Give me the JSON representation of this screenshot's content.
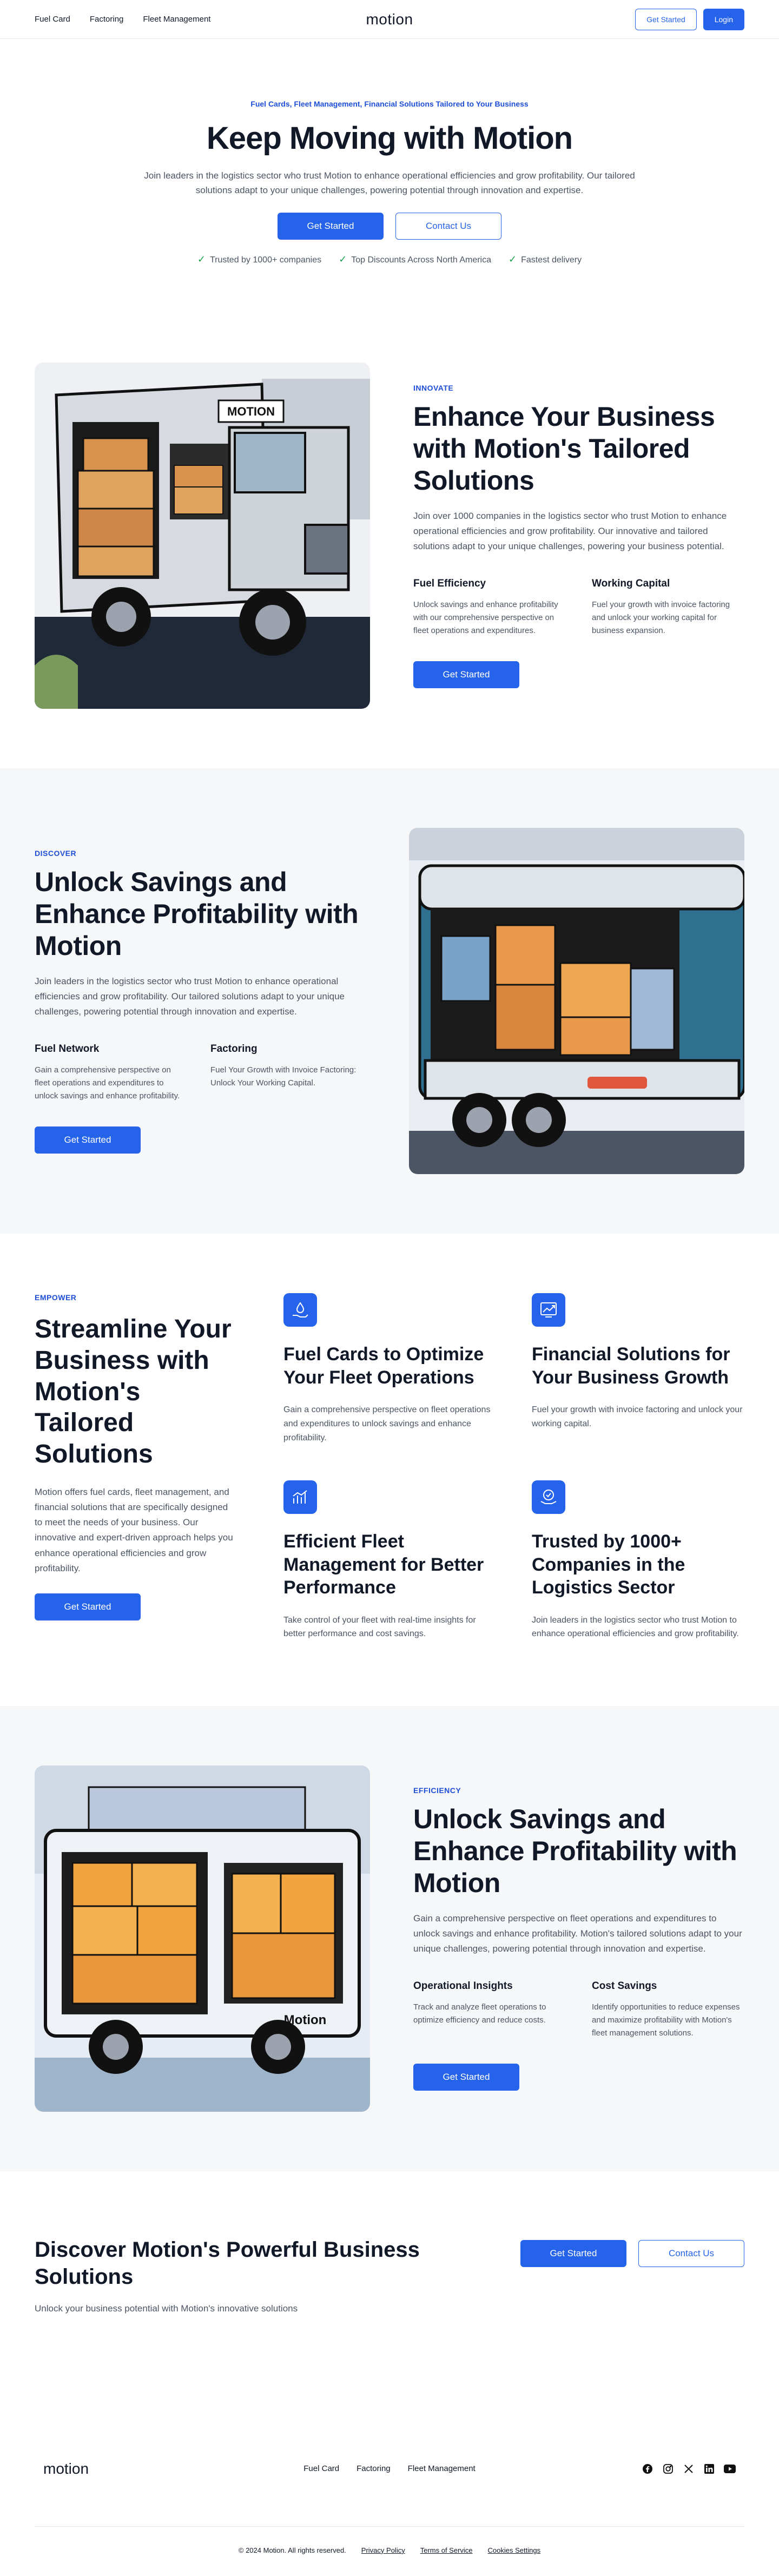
{
  "nav": {
    "links": [
      "Fuel Card",
      "Factoring",
      "Fleet Management"
    ],
    "logo": "motion",
    "get_started": "Get Started",
    "login": "Login"
  },
  "hero": {
    "eyebrow": "Fuel Cards, Fleet Management, Financial Solutions Tailored to Your Business",
    "title": "Keep Moving with Motion",
    "subtitle": "Join leaders in the logistics sector who trust Motion to enhance operational efficiencies and grow profitability. Our tailored solutions adapt to your unique challenges, powering potential through innovation and expertise.",
    "primary_btn": "Get Started",
    "secondary_btn": "Contact Us",
    "checks": [
      "Trusted by 1000+ companies",
      "Top Discounts Across North America",
      "Fastest delivery"
    ]
  },
  "innovate": {
    "eyebrow": "INNOVATE",
    "title": "Enhance Your Business with Motion's Tailored Solutions",
    "desc": "Join over 1000 companies in the logistics sector who trust Motion to enhance operational efficiencies and grow profitability. Our innovative and tailored solutions adapt to your unique challenges, powering your business potential.",
    "col1_title": "Fuel Efficiency",
    "col1_desc": "Unlock savings and enhance profitability with our comprehensive perspective on fleet operations and expenditures.",
    "col2_title": "Working Capital",
    "col2_desc": "Fuel your growth with invoice factoring and unlock your working capital for business expansion.",
    "button": "Get Started",
    "truck_label": "MOTION"
  },
  "discover": {
    "eyebrow": "DISCOVER",
    "title": "Unlock Savings and Enhance Profitability with Motion",
    "desc": "Join leaders in the logistics sector who trust Motion to enhance operational efficiencies and grow profitability. Our tailored solutions adapt to your unique challenges, powering potential through innovation and expertise.",
    "col1_title": "Fuel Network",
    "col1_desc": "Gain a comprehensive perspective on fleet operations and expenditures to unlock savings and enhance profitability.",
    "col2_title": "Factoring",
    "col2_desc": "Fuel Your Growth with Invoice Factoring: Unlock Your Working Capital.",
    "button": "Get Started"
  },
  "empower": {
    "eyebrow": "EMPOWER",
    "title": "Streamline Your Business with Motion's Tailored Solutions",
    "desc": "Motion offers fuel cards, fleet management, and financial solutions that are specifically designed to meet the needs of your business. Our innovative and expert-driven approach helps you enhance operational efficiencies and grow profitability.",
    "button": "Get Started",
    "cards": [
      {
        "icon": "fuel-hand-icon",
        "title": "Fuel Cards to Optimize Your Fleet Operations",
        "desc": "Gain a comprehensive perspective on fleet operations and expenditures to unlock savings and enhance profitability."
      },
      {
        "icon": "growth-chart-icon",
        "title": "Financial Solutions for Your Business Growth",
        "desc": "Fuel your growth with invoice factoring and unlock your working capital."
      },
      {
        "icon": "bar-chart-icon",
        "title": "Efficient Fleet Management for Better Performance",
        "desc": "Take control of your fleet with real-time insights for better performance and cost savings."
      },
      {
        "icon": "handshake-icon",
        "title": "Trusted by 1000+ Companies in the Logistics Sector",
        "desc": "Join leaders in the logistics sector who trust Motion to enhance operational efficiencies and grow profitability."
      }
    ]
  },
  "efficiency": {
    "eyebrow": "EFFICIENCY",
    "title": "Unlock Savings and Enhance Profitability with Motion",
    "desc": "Gain a comprehensive perspective on fleet operations and expenditures to unlock savings and enhance profitability. Motion's tailored solutions adapt to your unique challenges, powering potential through innovation and expertise.",
    "col1_title": "Operational Insights",
    "col1_desc": "Track and analyze fleet operations to optimize efficiency and reduce costs.",
    "col2_title": "Cost Savings",
    "col2_desc": "Identify opportunities to reduce expenses and maximize profitability with Motion's fleet management solutions.",
    "button": "Get Started",
    "truck_label": "Motion"
  },
  "cta": {
    "title": "Discover Motion's Powerful Business Solutions",
    "subtitle": "Unlock your business potential with Motion's innovative solutions",
    "primary_btn": "Get Started",
    "secondary_btn": "Contact Us"
  },
  "footer": {
    "logo": "motion",
    "links": [
      "Fuel Card",
      "Factoring",
      "Fleet Management"
    ],
    "social": [
      "facebook-icon",
      "instagram-icon",
      "x-icon",
      "linkedin-icon",
      "youtube-icon"
    ],
    "copyright": "© 2024 Motion. All rights reserved.",
    "privacy": "Privacy Policy",
    "terms": "Terms of Service",
    "cookies": "Cookies Settings"
  },
  "colors": {
    "primary": "#2563eb",
    "eyebrow": "#1d4ed8",
    "check": "#16a34a",
    "section_gray": "#f6f7f9"
  }
}
